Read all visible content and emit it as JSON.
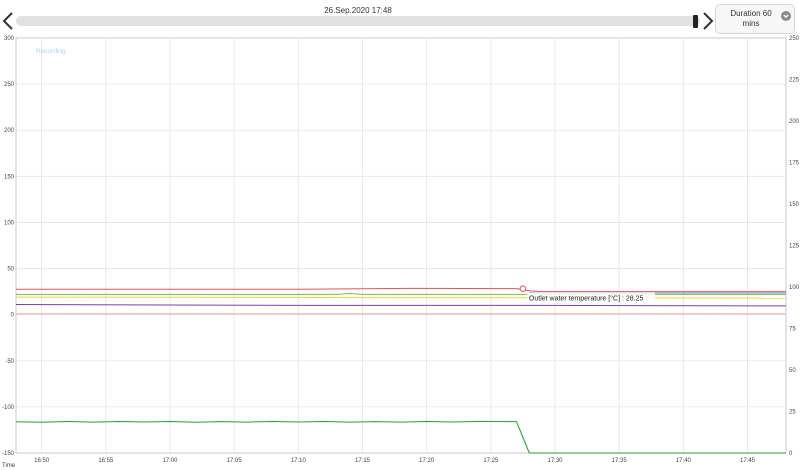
{
  "header": {
    "timestamp": "26.Sep.2020 17:48",
    "duration_label": "Duration 60 mins",
    "slider_position": 0.99
  },
  "chart_data": {
    "type": "line",
    "status_label": "Recording",
    "status_color": "#aed0ee",
    "xlabel": "Time",
    "x_ticks": [
      "16:50",
      "16:55",
      "17:00",
      "17:05",
      "17:10",
      "17:15",
      "17:20",
      "17:25",
      "17:30",
      "17:35",
      "17:40",
      "17:45"
    ],
    "x_range": [
      "16:48",
      "17:48"
    ],
    "y_left": {
      "range": [
        -150,
        300
      ],
      "ticks": [
        -150,
        -100,
        -50,
        0,
        50,
        100,
        150,
        200,
        250,
        300
      ]
    },
    "y_right": {
      "range": [
        0,
        250
      ],
      "ticks": [
        0,
        25,
        50,
        75,
        100,
        125,
        150,
        175,
        200,
        225,
        250
      ]
    },
    "grid": true,
    "series": [
      {
        "color": "#e05563",
        "axis": "left",
        "points": [
          [
            "16:48",
            27.5
          ],
          [
            "17:10",
            27.5
          ],
          [
            "17:19",
            28.5
          ],
          [
            "17:27",
            28.3
          ],
          [
            "17:28",
            26
          ],
          [
            "17:29",
            25
          ],
          [
            "17:48",
            25
          ]
        ]
      },
      {
        "color": "#6f9ad7",
        "axis": "left",
        "points": [
          [
            "17:28",
            24
          ],
          [
            "17:29",
            23.5
          ],
          [
            "17:48",
            23.5
          ]
        ]
      },
      {
        "color": "#7bbd4c",
        "axis": "left",
        "points": [
          [
            "16:48",
            22
          ],
          [
            "17:13",
            22
          ],
          [
            "17:14",
            23
          ],
          [
            "17:15",
            22
          ],
          [
            "17:28",
            22
          ],
          [
            "17:48",
            22
          ]
        ]
      },
      {
        "color": "#ead24e",
        "axis": "left",
        "points": [
          [
            "16:48",
            19
          ],
          [
            "17:48",
            18
          ]
        ]
      },
      {
        "color": "#7a3fb8",
        "axis": "left",
        "points": [
          [
            "16:48",
            11
          ],
          [
            "17:10",
            10
          ],
          [
            "17:29",
            10
          ],
          [
            "17:48",
            9.5
          ]
        ]
      },
      {
        "color": "#f7a8b0",
        "axis": "left",
        "points": [
          [
            "16:48",
            1
          ],
          [
            "17:48",
            1
          ]
        ]
      },
      {
        "color": "#2a9d3a",
        "axis": "right",
        "points": [
          [
            "16:48",
            18.8
          ],
          [
            "16:50",
            18.5
          ],
          [
            "16:52",
            19.0
          ],
          [
            "16:54",
            18.6
          ],
          [
            "16:56",
            19.0
          ],
          [
            "16:58",
            18.7
          ],
          [
            "17:00",
            19.0
          ],
          [
            "17:02",
            18.5
          ],
          [
            "17:04",
            18.9
          ],
          [
            "17:06",
            18.6
          ],
          [
            "17:08",
            19.0
          ],
          [
            "17:10",
            18.7
          ],
          [
            "17:12",
            19.0
          ],
          [
            "17:14",
            18.6
          ],
          [
            "17:16",
            18.9
          ],
          [
            "17:18",
            18.6
          ],
          [
            "17:20",
            19.0
          ],
          [
            "17:22",
            18.7
          ],
          [
            "17:24",
            19.0
          ],
          [
            "17:27",
            18.9
          ],
          [
            "17:28",
            0
          ],
          [
            "17:48",
            0
          ]
        ]
      }
    ],
    "tooltip": {
      "text": "Outlet water temperature [°C] : 28.25",
      "x": "17:27.5",
      "y": 28.25
    }
  }
}
